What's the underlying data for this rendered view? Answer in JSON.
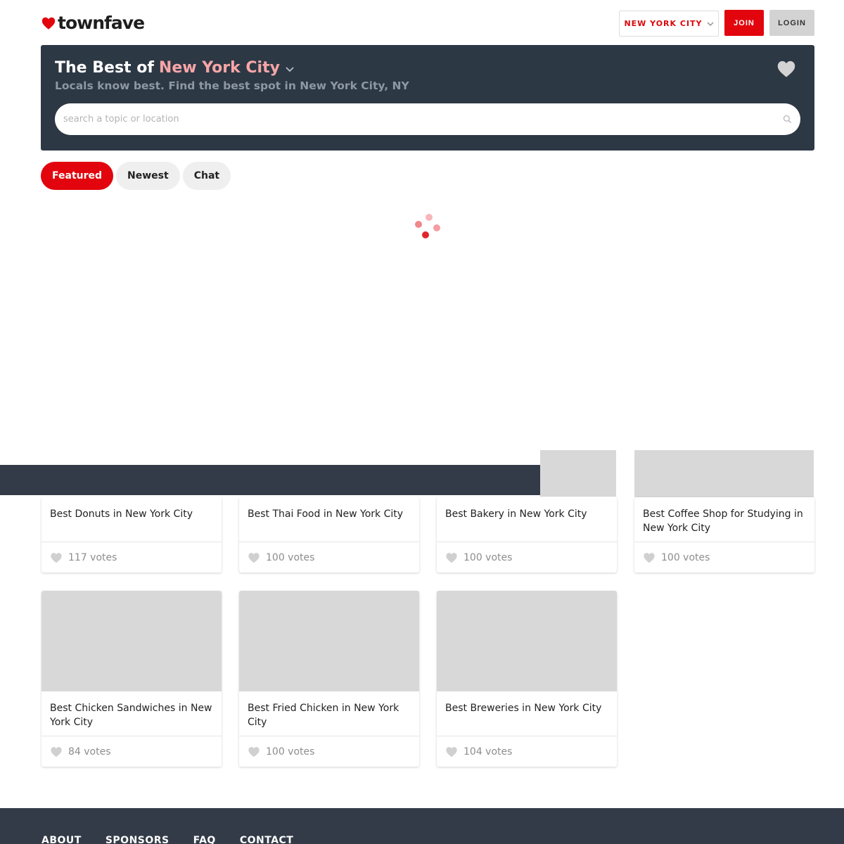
{
  "header": {
    "logo_text": "townfave",
    "city_select_label": "NEW YORK CITY",
    "join_label": "JOIN",
    "login_label": "LOGIN"
  },
  "hero": {
    "title_prefix": "The Best of",
    "city": "New York City",
    "subtitle": "Locals know best. Find the best spot in New York City, NY"
  },
  "search": {
    "placeholder": "search a topic or location",
    "value": ""
  },
  "tabs": [
    {
      "label": "Featured",
      "active": true
    },
    {
      "label": "Newest",
      "active": false
    },
    {
      "label": "Chat",
      "active": false
    }
  ],
  "cards": [
    {
      "title": "Best Donuts in New York City",
      "votes": "117 votes"
    },
    {
      "title": "Best Thai Food in New York City",
      "votes": "100 votes"
    },
    {
      "title": "Best Bakery in New York City",
      "votes": "100 votes"
    },
    {
      "title": "Best Coffee Shop for Studying in New York City",
      "votes": "100 votes"
    },
    {
      "title": "Best Chicken Sandwiches in New York City",
      "votes": "84 votes"
    },
    {
      "title": "Best Fried Chicken in New York City",
      "votes": "100 votes"
    },
    {
      "title": "Best Breweries in New York City",
      "votes": "104 votes"
    }
  ],
  "footer": {
    "links": [
      "ABOUT",
      "SPONSORS",
      "FAQ",
      "CONTACT"
    ]
  },
  "colors": {
    "brand_red": "#e2050d",
    "hero_bg": "#2d3845",
    "hero_city": "#f6a6a7",
    "footer_bg": "#323b47"
  },
  "icons": {
    "logo": "heart-icon",
    "city_select": "chevron-down-icon",
    "favorite": "heart-icon",
    "search": "search-icon",
    "vote": "heart-icon",
    "loading": "loading-spinner"
  }
}
